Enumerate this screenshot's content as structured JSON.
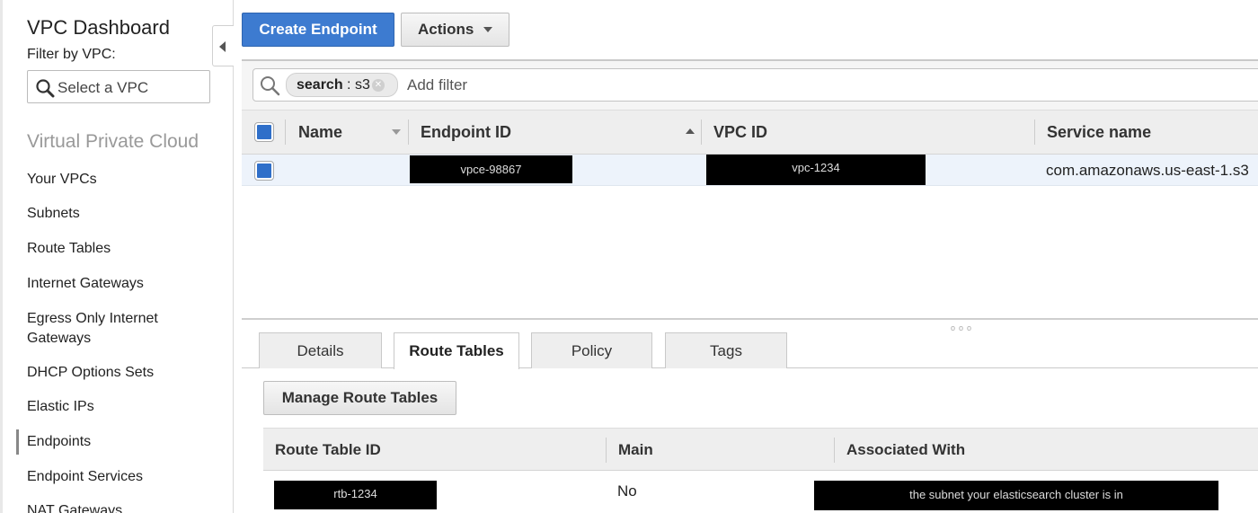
{
  "sidebar": {
    "title": "VPC Dashboard",
    "filter_label": "Filter by VPC:",
    "vpc_select_placeholder": "Select a VPC",
    "section_title": "Virtual Private Cloud",
    "items": [
      {
        "label": "Your VPCs"
      },
      {
        "label": "Subnets"
      },
      {
        "label": "Route Tables"
      },
      {
        "label": "Internet Gateways"
      },
      {
        "label": "Egress Only Internet Gateways"
      },
      {
        "label": "DHCP Options Sets"
      },
      {
        "label": "Elastic IPs"
      },
      {
        "label": "Endpoints"
      },
      {
        "label": "Endpoint Services"
      },
      {
        "label": "NAT Gateways"
      }
    ],
    "active_item": "Endpoints"
  },
  "toolbar": {
    "create_label": "Create Endpoint",
    "actions_label": "Actions"
  },
  "search": {
    "tag_key": "search",
    "tag_value": "s3",
    "add_filter_placeholder": "Add filter"
  },
  "endpoints_table": {
    "columns": [
      "Name",
      "Endpoint ID",
      "VPC ID",
      "Service name"
    ],
    "rows": [
      {
        "name": "",
        "endpoint_id": "vpce-98867",
        "vpc_id": "vpc-1234",
        "service_name": "com.amazonaws.us-east-1.s3"
      }
    ]
  },
  "detail_tabs": [
    {
      "label": "Details"
    },
    {
      "label": "Route Tables"
    },
    {
      "label": "Policy"
    },
    {
      "label": "Tags"
    }
  ],
  "active_tab": "Route Tables",
  "route_tables": {
    "manage_label": "Manage Route Tables",
    "columns": [
      "Route Table ID",
      "Main",
      "Associated With"
    ],
    "rows": [
      {
        "route_table_id": "rtb-1234",
        "main": "No",
        "associated_with": "the subnet your elasticsearch cluster is in"
      }
    ]
  },
  "colors": {
    "primary_button": "#3d7bd0",
    "selected_row": "#edf3fb",
    "redaction": "#000000"
  },
  "icons": [
    "search-icon",
    "collapse-left-icon",
    "caret-down-icon",
    "clear-filter-icon",
    "sort-descending-icon",
    "sort-ascending-icon"
  ]
}
